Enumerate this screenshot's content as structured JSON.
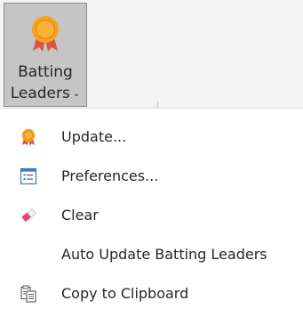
{
  "ribbon": {
    "button": {
      "label_line1": "Batting",
      "label_line2": "Leaders",
      "dropdown_glyph": "⌄",
      "icon": "medal-icon"
    }
  },
  "menu": {
    "items": [
      {
        "label": "Update...",
        "icon": "medal-icon"
      },
      {
        "label": "Preferences...",
        "icon": "preferences-icon"
      },
      {
        "label": "Clear",
        "icon": "eraser-icon"
      },
      {
        "label": "Auto Update Batting Leaders",
        "icon": ""
      },
      {
        "label": "Copy to Clipboard",
        "icon": "clipboard-icon"
      }
    ]
  },
  "colors": {
    "ribbon_bg": "#f3f3f3",
    "button_pressed_bg": "#c5c5c5",
    "medal_gold": "#f7a21b",
    "medal_ribbon": "#d9534f",
    "eraser_pink": "#e8436a",
    "text": "#262626",
    "icon_blue": "#3e7bc1"
  }
}
